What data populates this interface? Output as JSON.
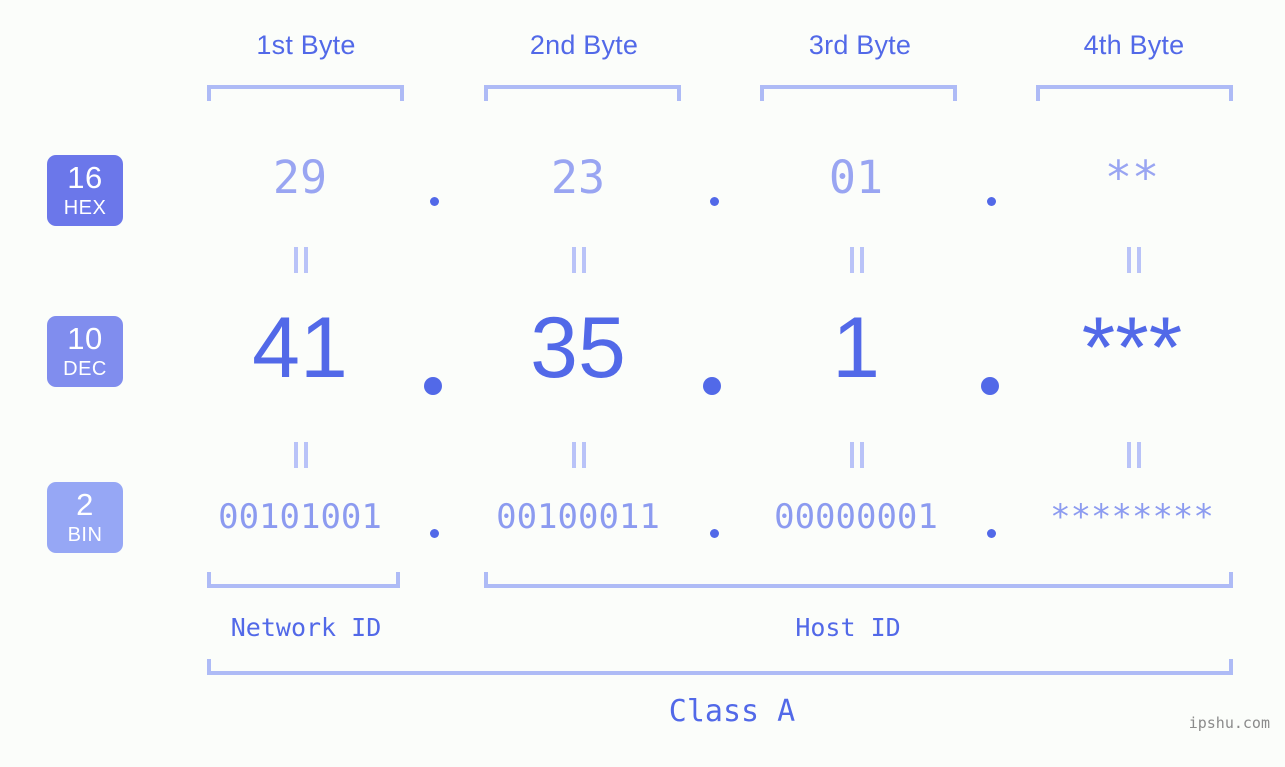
{
  "background_color": "#fbfdfa",
  "accent_color": "#5269e8",
  "bracket_color": "#aebbf6",
  "byte_headers": [
    {
      "label": "1st Byte"
    },
    {
      "label": "2nd Byte"
    },
    {
      "label": "3rd Byte"
    },
    {
      "label": "4th Byte"
    }
  ],
  "rows": [
    {
      "base": "16",
      "name": "HEX",
      "badge_color": "#6b77ea",
      "text_color": "#99a5f2",
      "values": [
        "29",
        "23",
        "01",
        "**"
      ]
    },
    {
      "base": "10",
      "name": "DEC",
      "badge_color": "#808dee",
      "text_color": "#5269e8",
      "values": [
        "41",
        "35",
        "1",
        "***"
      ]
    },
    {
      "base": "2",
      "name": "BIN",
      "badge_color": "#96a7f5",
      "text_color": "#8c9bf0",
      "values": [
        "00101001",
        "00100011",
        "00000001",
        "********"
      ]
    }
  ],
  "separator": ".",
  "equality_symbol": "=",
  "id_sections": [
    {
      "label": "Network ID"
    },
    {
      "label": "Host ID"
    }
  ],
  "class_label": "Class A",
  "watermark": "ipshu.com"
}
